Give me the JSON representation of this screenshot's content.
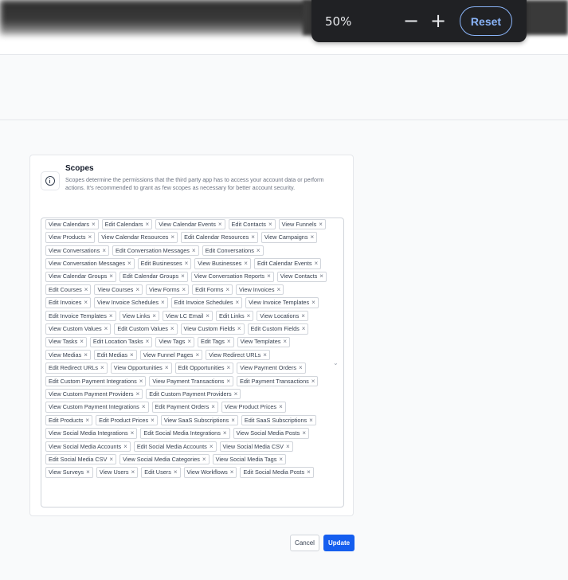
{
  "browser_zoom": {
    "level": "50%",
    "minus_label": "−",
    "plus_label": "+",
    "reset_label": "Reset"
  },
  "scopes_card": {
    "title": "Scopes",
    "description": "Scopes determine the permissions that the third party app has to access your account data or perform actions. It's recommended to grant as few scopes as necessary for better account security.",
    "remove_icon": "×",
    "dropdown_icon": "⌄",
    "selected": [
      "View Calendars",
      "Edit Calendars",
      "View Calendar Events",
      "Edit Contacts",
      "View Funnels",
      "View Products",
      "View Calendar Resources",
      "Edit Calendar Resources",
      "View Campaigns",
      "View Conversations",
      "Edit Conversation Messages",
      "Edit Conversations",
      "View Conversation Messages",
      "Edit Businesses",
      "View Businesses",
      "Edit Calendar Events",
      "View Calendar Groups",
      "Edit Calendar Groups",
      "View Conversation Reports",
      "View Contacts",
      "Edit Courses",
      "View Courses",
      "View Forms",
      "Edit Forms",
      "View Invoices",
      "Edit Invoices",
      "View Invoice Schedules",
      "Edit Invoice Schedules",
      "View Invoice Templates",
      "Edit Invoice Templates",
      "View Links",
      "View LC Email",
      "Edit Links",
      "View Locations",
      "View Custom Values",
      "Edit Custom Values",
      "View Custom Fields",
      "Edit Custom Fields",
      "View Tasks",
      "Edit Location Tasks",
      "View Tags",
      "Edit Tags",
      "View Templates",
      "View Medias",
      "Edit Medias",
      "View Funnel Pages",
      "View Redirect URLs",
      "Edit Redirect URLs",
      "View Opportunities",
      "Edit Opportunities",
      "View Payment Orders",
      "Edit Custom Payment Integrations",
      "View Payment Transactions",
      "Edit Payment Transactions",
      "View Custom Payment Providers",
      "Edit Custom Payment Providers",
      "View Custom Payment Integrations",
      "Edit Payment Orders",
      "View Product Prices",
      "Edit Products",
      "Edit Product Prices",
      "View SaaS Subscriptions",
      "Edit SaaS Subscriptions",
      "View Social Media Integrations",
      "Edit Social Media Integrations",
      "View Social Media Posts",
      "View Social Media Accounts",
      "Edit Social Media Accounts",
      "View Social Media CSV",
      "Edit Social Media CSV",
      "View Social Media Categories",
      "View Social Media Tags",
      "View Surveys",
      "View Users",
      "Edit Users",
      "View Workflows",
      "Edit Social Media Posts"
    ]
  },
  "actions": {
    "cancel_label": "Cancel",
    "update_label": "Update"
  },
  "colors": {
    "primary": "#155eef",
    "zoom_accent": "#8ab4f8",
    "zoom_bg": "#202124"
  }
}
